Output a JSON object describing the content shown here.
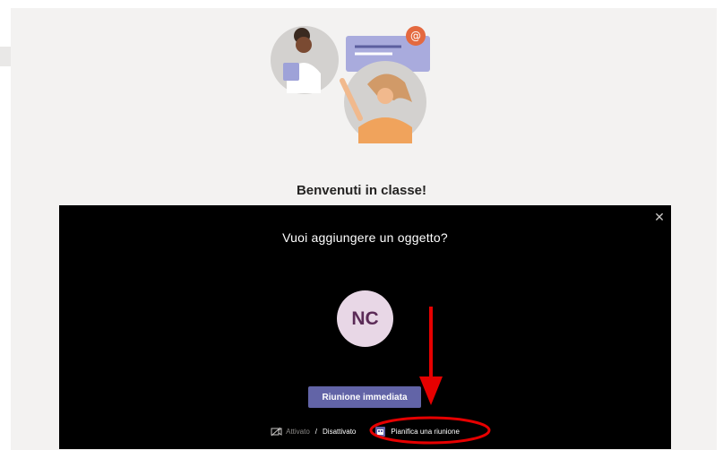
{
  "welcome": {
    "title": "Benvenuti in classe!"
  },
  "dialog": {
    "title": "Vuoi aggiungere un oggetto?",
    "close_icon": "close-icon",
    "avatar_initials": "NC",
    "meet_now_label": "Riunione immediata",
    "video_toggle": {
      "on_label": "Attivato",
      "separator": "/",
      "off_label": "Disattivato",
      "icon": "camera-off-icon"
    },
    "schedule": {
      "label": "Pianifica una riunione",
      "icon": "calendar-icon"
    }
  },
  "colors": {
    "page_background": "#f3f2f1",
    "overlay": "#000000",
    "primary_button": "#6264a7",
    "avatar_background": "#e8d7e6",
    "avatar_text": "#5b2b57",
    "annotation": "#e60000"
  }
}
